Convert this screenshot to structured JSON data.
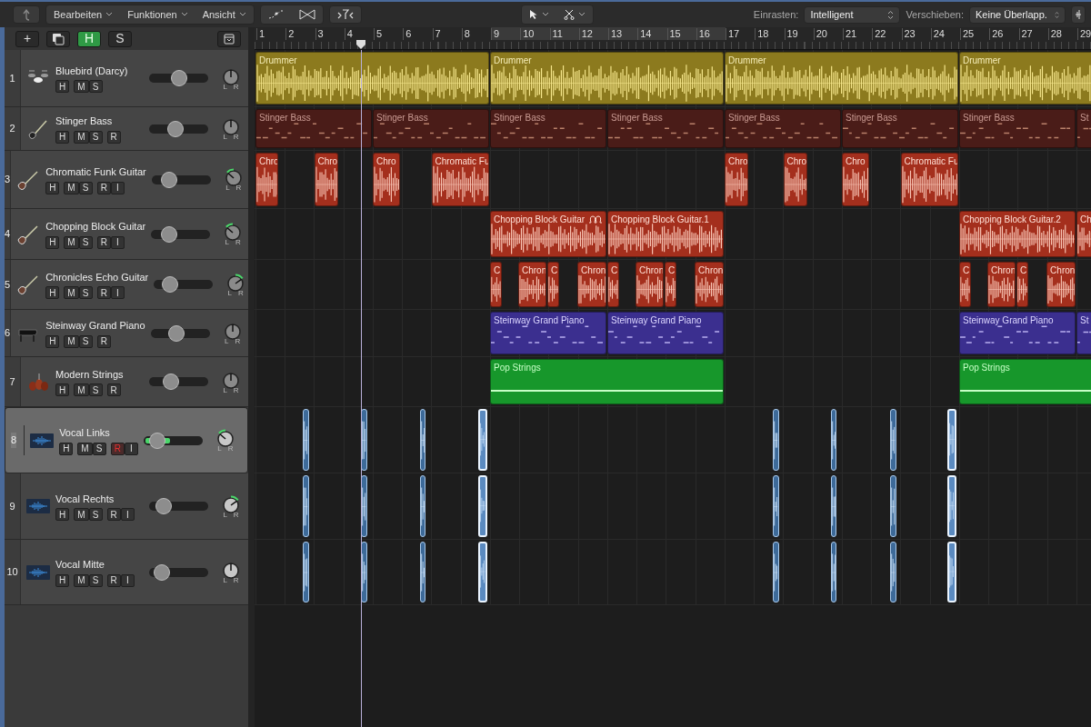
{
  "toolbar": {
    "menus": [
      {
        "label": "Bearbeiten"
      },
      {
        "label": "Funktionen"
      },
      {
        "label": "Ansicht"
      }
    ],
    "snap": {
      "label": "Einrasten:",
      "value": "Intelligent"
    },
    "drag": {
      "label": "Verschieben:",
      "value": "Keine Überlapp."
    }
  },
  "track_toolbar": {
    "buttons": [
      {
        "label": "+",
        "on": false
      },
      {
        "label": "H",
        "on": true
      },
      {
        "label": "S",
        "on": false
      }
    ]
  },
  "ruler": {
    "bars": [
      "1",
      "2",
      "3",
      "4",
      "5",
      "6",
      "7",
      "8",
      "9",
      "10",
      "11",
      "12",
      "13",
      "14",
      "15",
      "16",
      "17",
      "18",
      "19",
      "20",
      "21",
      "22",
      "23",
      "24",
      "25",
      "26",
      "27",
      "28",
      "29"
    ]
  },
  "tracks": [
    {
      "number": "1",
      "name": "Bluebird (Darcy)",
      "kind": "drums",
      "color": "#8c7a1e",
      "selected": false,
      "buttons": [
        {
          "label": "H",
          "on": false
        },
        {
          "label": "M",
          "on": false
        },
        {
          "label": "S",
          "on": false
        }
      ],
      "volume": {
        "level": 0.5
      },
      "pan_left": false,
      "pan_right": false,
      "pan_scale": [
        "L",
        "R"
      ],
      "regions": [
        {
          "label": "Drummer"
        },
        {
          "label": "Drummer"
        },
        {
          "label": "Drummer"
        },
        {
          "label": "Drummer"
        }
      ]
    },
    {
      "number": "2",
      "name": "Stinger Bass",
      "kind": "bass",
      "color": "#4a1c18",
      "selected": false,
      "buttons": [
        {
          "label": "H",
          "on": false
        },
        {
          "label": "M",
          "on": false
        },
        {
          "label": "S",
          "on": false
        },
        {
          "label": "R",
          "on": false
        }
      ],
      "volume": {
        "level": 0.45
      },
      "pan_left": false,
      "pan_right": false,
      "pan_scale": [
        "L",
        "R"
      ],
      "regions": [
        {
          "label": "Stinger Bass"
        },
        {
          "label": "Stinger Bass"
        },
        {
          "label": "Stinger Bass"
        },
        {
          "label": "Stinger Bass"
        },
        {
          "label": "Stinger Bass"
        },
        {
          "label": "Stinger Bass"
        },
        {
          "label": "Stinger Bass"
        },
        {
          "label": "St"
        }
      ]
    },
    {
      "number": "3",
      "name": "Chromatic Funk Guitar",
      "kind": "guitar",
      "color": "#a42f1d",
      "selected": false,
      "buttons": [
        {
          "label": "H",
          "on": false
        },
        {
          "label": "M",
          "on": false
        },
        {
          "label": "S",
          "on": false
        },
        {
          "label": "R",
          "on": false
        },
        {
          "label": "I",
          "on": false
        }
      ],
      "volume": {
        "level": 0.3
      },
      "pan_left": true,
      "pan_right": false,
      "pan_scale": [
        "L",
        "R"
      ],
      "regions": [
        {
          "label": "Chro"
        },
        {
          "label": "Chro"
        },
        {
          "label": "Chro"
        },
        {
          "label": "Chromatic Fu"
        },
        {
          "label": "Chro"
        },
        {
          "label": "Chro"
        },
        {
          "label": "Chro"
        },
        {
          "label": "Chromatic Fu"
        }
      ]
    },
    {
      "number": "4",
      "name": "Chopping Block Guitar",
      "kind": "guitar",
      "color": "#a42f1d",
      "selected": false,
      "buttons": [
        {
          "label": "H",
          "on": false
        },
        {
          "label": "M",
          "on": false
        },
        {
          "label": "S",
          "on": false
        },
        {
          "label": "R",
          "on": false
        },
        {
          "label": "I",
          "on": false
        }
      ],
      "volume": {
        "level": 0.3
      },
      "pan_left": true,
      "pan_right": false,
      "pan_scale": [
        "L",
        "R"
      ],
      "regions": [
        {
          "label": "Chopping Block Guitar",
          "looped": true
        },
        {
          "label": "Chopping Block Guitar.1"
        },
        {
          "label": "Chopping Block Guitar.2"
        },
        {
          "label": "Ch"
        }
      ]
    },
    {
      "number": "5",
      "name": "Chronicles Echo Guitar",
      "kind": "guitar",
      "color": "#a42f1d",
      "selected": false,
      "buttons": [
        {
          "label": "H",
          "on": false
        },
        {
          "label": "M",
          "on": false
        },
        {
          "label": "S",
          "on": false
        },
        {
          "label": "R",
          "on": false
        },
        {
          "label": "I",
          "on": false
        }
      ],
      "volume": {
        "level": 0.27
      },
      "pan_left": false,
      "pan_right": true,
      "pan_scale": [
        "L",
        "R"
      ],
      "regions": [
        {
          "label": "C"
        },
        {
          "label": "Chron"
        },
        {
          "label": "C"
        },
        {
          "label": "Chron"
        },
        {
          "label": "C"
        },
        {
          "label": "Chron"
        },
        {
          "label": "C"
        },
        {
          "label": "Chron"
        },
        {
          "label": "C"
        },
        {
          "label": "Chron"
        },
        {
          "label": "C"
        },
        {
          "label": "Chron"
        }
      ]
    },
    {
      "number": "6",
      "name": "Steinway Grand Piano",
      "kind": "piano",
      "color": "#3b2f8f",
      "selected": false,
      "buttons": [
        {
          "label": "H",
          "on": false
        },
        {
          "label": "M",
          "on": false
        },
        {
          "label": "S",
          "on": false
        },
        {
          "label": "R",
          "on": false
        }
      ],
      "volume": {
        "level": 0.43
      },
      "pan_left": false,
      "pan_right": false,
      "pan_scale": [
        "L",
        "R"
      ],
      "regions": [
        {
          "label": "Steinway Grand Piano"
        },
        {
          "label": "Steinway Grand Piano"
        },
        {
          "label": "Steinway Grand Piano"
        },
        {
          "label": "St"
        }
      ]
    },
    {
      "number": "7",
      "name": "Modern Strings",
      "kind": "strings",
      "color": "#17972b",
      "selected": false,
      "buttons": [
        {
          "label": "H",
          "on": false
        },
        {
          "label": "M",
          "on": false
        },
        {
          "label": "S",
          "on": false
        },
        {
          "label": "R",
          "on": false
        }
      ],
      "volume": {
        "level": 0.37
      },
      "pan_left": false,
      "pan_right": false,
      "pan_scale": [
        "L",
        "R"
      ],
      "regions": [
        {
          "label": "Pop Strings"
        },
        {
          "label": "Pop Strings"
        }
      ]
    },
    {
      "number": "8",
      "name": "Vocal Links",
      "kind": "audio",
      "color": "#3d6a99",
      "selected": true,
      "buttons": [
        {
          "label": "H",
          "on": false
        },
        {
          "label": "M",
          "on": false
        },
        {
          "label": "S",
          "on": false
        },
        {
          "label": "R",
          "on": true
        },
        {
          "label": "I",
          "on": false
        }
      ],
      "volume": {
        "level": 0.23
      },
      "input_meter": {
        "level": 0.45
      },
      "pan_left": true,
      "pan_right": false,
      "pan_scale": [
        "L",
        "R"
      ],
      "regions": [
        {
          "selected": false
        },
        {
          "selected": false
        },
        {
          "selected": false
        },
        {
          "selected": true
        },
        {
          "selected": false
        },
        {
          "selected": false
        },
        {
          "selected": false
        },
        {
          "selected": true
        }
      ]
    },
    {
      "number": "9",
      "name": "Vocal Rechts",
      "kind": "audio",
      "color": "#3d6a99",
      "selected": false,
      "buttons": [
        {
          "label": "H",
          "on": false
        },
        {
          "label": "M",
          "on": false
        },
        {
          "label": "S",
          "on": false
        },
        {
          "label": "R",
          "on": false
        },
        {
          "label": "I",
          "on": false
        }
      ],
      "volume": {
        "level": 0.25
      },
      "pan_left": false,
      "pan_right": true,
      "pan_scale": [
        "L",
        "R"
      ],
      "regions": [
        {
          "selected": false
        },
        {
          "selected": false
        },
        {
          "selected": false
        },
        {
          "selected": true
        },
        {
          "selected": false
        },
        {
          "selected": false
        },
        {
          "selected": false
        },
        {
          "selected": true
        }
      ]
    },
    {
      "number": "10",
      "name": "Vocal Mitte",
      "kind": "audio",
      "color": "#3d6a99",
      "selected": false,
      "buttons": [
        {
          "label": "H",
          "on": false
        },
        {
          "label": "M",
          "on": false
        },
        {
          "label": "S",
          "on": false
        },
        {
          "label": "R",
          "on": false
        },
        {
          "label": "I",
          "on": false
        }
      ],
      "volume": {
        "level": 0.22
      },
      "pan_left": false,
      "pan_right": false,
      "pan_scale": [
        "L",
        "R"
      ],
      "regions": [
        {
          "selected": false
        },
        {
          "selected": false
        },
        {
          "selected": false
        },
        {
          "selected": true
        },
        {
          "selected": false
        },
        {
          "selected": false
        },
        {
          "selected": false
        },
        {
          "selected": true
        }
      ]
    }
  ]
}
